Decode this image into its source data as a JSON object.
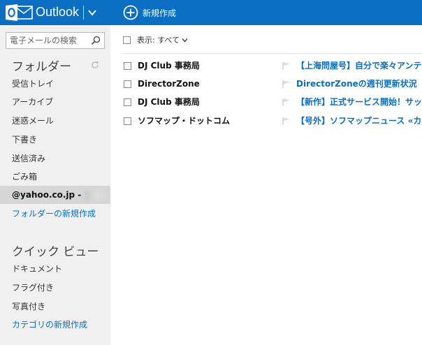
{
  "header": {
    "app_name": "Outlook",
    "new_label": "新規作成"
  },
  "sidebar": {
    "search_placeholder": "電子メールの検索",
    "folders_title": "フォルダー",
    "folders": [
      {
        "label": "受信トレイ"
      },
      {
        "label": "アーカイブ"
      },
      {
        "label": "迷惑メール"
      },
      {
        "label": "下書き"
      },
      {
        "label": "送信済み"
      },
      {
        "label": "ごみ箱"
      }
    ],
    "account_label": "@yahoo.co.jp -",
    "new_folder_label": "フォルダーの新規作成",
    "quick_views_title": "クイック ビュー",
    "quick_views": [
      {
        "label": "ドキュメント"
      },
      {
        "label": "フラグ付き"
      },
      {
        "label": "写真付き"
      }
    ],
    "new_category_label": "カテゴリの新規作成"
  },
  "filter": {
    "label": "表示: すべて"
  },
  "messages": [
    {
      "sender": "DJ Club 事務局",
      "subject": "【上海問屋号】自分で楽々アンテナ"
    },
    {
      "sender": "DirectorZone",
      "subject": "DirectorZoneの週刊更新状況"
    },
    {
      "sender": "DJ Club 事務局",
      "subject": "【新作】正式サービス開始！サッカー"
    },
    {
      "sender": "ソフマップ・ドットコム",
      "subject": "【号外】ソフマップニュース «カード発"
    }
  ],
  "colors": {
    "brand_blue": "#0a6fc2",
    "sidebar_bg": "#f0f0f0",
    "selected_bg": "#d6d6d6"
  }
}
